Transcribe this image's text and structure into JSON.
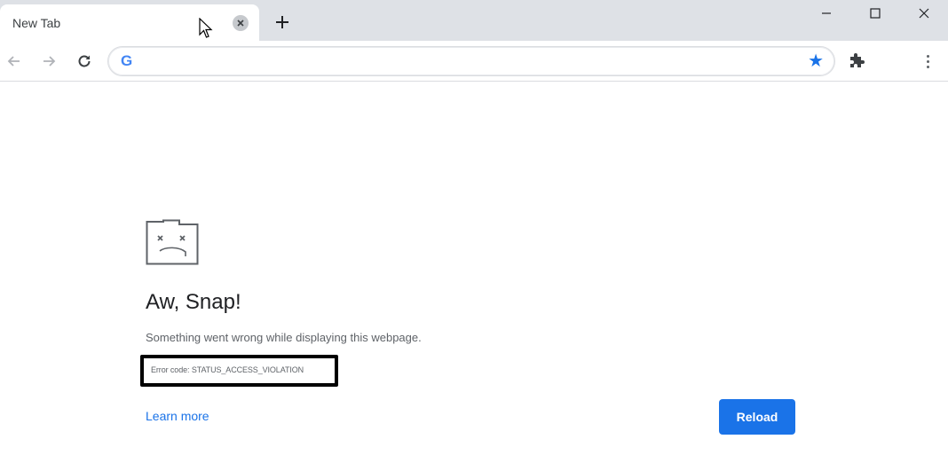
{
  "browser": {
    "tab": {
      "title": "New Tab"
    },
    "omnibox": {
      "value": ""
    },
    "icons": {
      "back": "arrow-left-icon",
      "forward": "arrow-right-icon",
      "reload": "reload-icon",
      "google": "google-icon",
      "bookmark": "star-icon",
      "extensions": "puzzle-icon",
      "menu": "kebab-menu-icon"
    },
    "accent_color": "#1a73e8"
  },
  "error_page": {
    "heading": "Aw, Snap!",
    "message": "Something went wrong while displaying this webpage.",
    "error_code": "Error code: STATUS_ACCESS_VIOLATION",
    "learn_more": "Learn more",
    "reload_label": "Reload"
  }
}
